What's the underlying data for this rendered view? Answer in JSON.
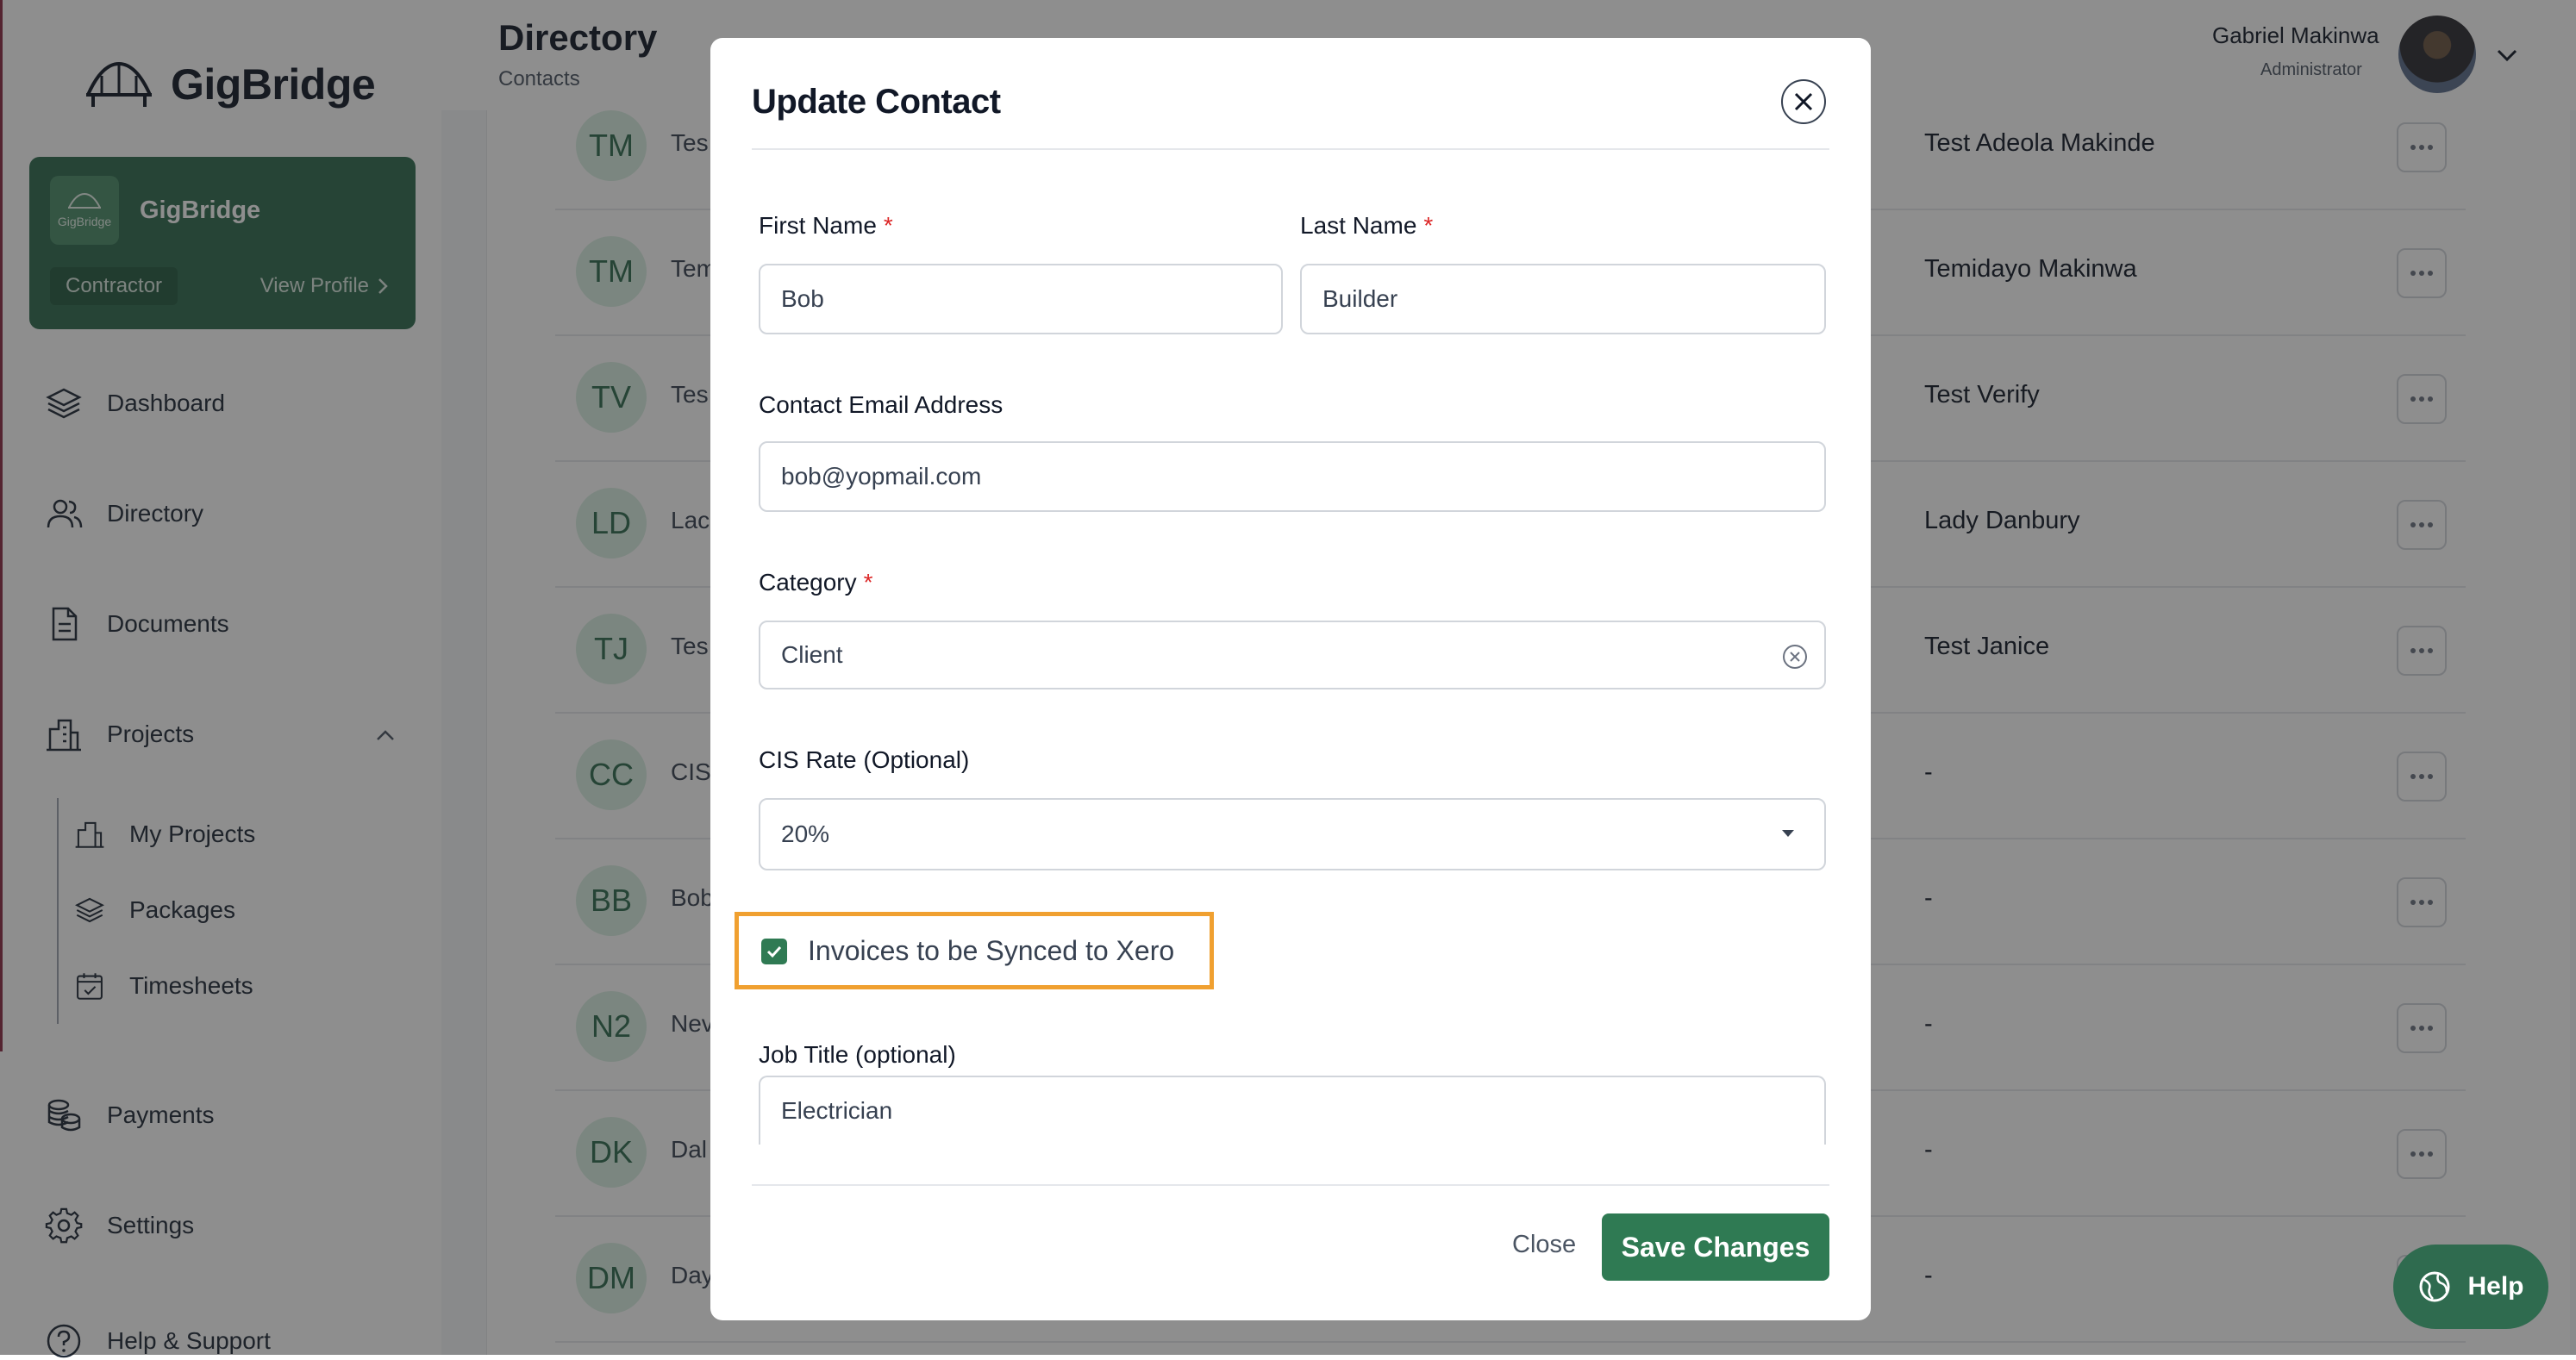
{
  "brand": {
    "name": "GigBridge"
  },
  "profile_card": {
    "logo_text": "GigBridge",
    "name": "GigBridge",
    "role": "Contractor",
    "view_profile": "View Profile"
  },
  "sidebar": {
    "items": [
      {
        "label": "Dashboard",
        "icon": "layers-icon"
      },
      {
        "label": "Directory",
        "icon": "users-icon"
      },
      {
        "label": "Documents",
        "icon": "document-icon"
      },
      {
        "label": "Projects",
        "icon": "building-icon"
      },
      {
        "label": "Payments",
        "icon": "coins-icon"
      },
      {
        "label": "Settings",
        "icon": "gear-icon"
      },
      {
        "label": "Help & Support",
        "icon": "help-icon"
      }
    ],
    "sub_items": [
      {
        "label": "My Projects",
        "icon": "building-icon"
      },
      {
        "label": "Packages",
        "icon": "layers-icon"
      },
      {
        "label": "Timesheets",
        "icon": "calendar-check-icon"
      }
    ]
  },
  "header": {
    "title": "Directory",
    "subtitle": "Contacts"
  },
  "user": {
    "name": "Gabriel Makinwa",
    "role": "Administrator"
  },
  "contacts": [
    {
      "initials": "TM",
      "short": "Tes",
      "full": "Test Adeola Makinde"
    },
    {
      "initials": "TM",
      "short": "Tem",
      "full": "Temidayo Makinwa"
    },
    {
      "initials": "TV",
      "short": "Tes",
      "full": "Test Verify"
    },
    {
      "initials": "LD",
      "short": "Lac",
      "full": "Lady Danbury"
    },
    {
      "initials": "TJ",
      "short": "Tes",
      "full": "Test Janice"
    },
    {
      "initials": "CC",
      "short": "CIS",
      "full": "-"
    },
    {
      "initials": "BB",
      "short": "Bob",
      "full": "-"
    },
    {
      "initials": "N2",
      "short": "Nev",
      "full": "-"
    },
    {
      "initials": "DK",
      "short": "Dal",
      "full": "-"
    },
    {
      "initials": "DM",
      "short": "Day",
      "full": "-"
    }
  ],
  "modal": {
    "title": "Update Contact",
    "first_name": {
      "label": "First Name",
      "required": "*",
      "value": "Bob"
    },
    "last_name": {
      "label": "Last Name",
      "required": "*",
      "value": "Builder"
    },
    "email": {
      "label": "Contact Email Address",
      "value": "bob@yopmail.com"
    },
    "category": {
      "label": "Category",
      "required": "*",
      "value": "Client"
    },
    "cis_rate": {
      "label": "CIS Rate (Optional)",
      "value": "20%"
    },
    "sync": {
      "label": "Invoices to be Synced to Xero",
      "checked": true
    },
    "job_title": {
      "label": "Job Title (optional)",
      "value": "Electrician"
    },
    "close_label": "Close",
    "save_label": "Save Changes"
  },
  "help_button": {
    "label": "Help"
  },
  "colors": {
    "brand_green": "#2f6b4f",
    "accent_orange": "#f0a030",
    "required_red": "#dc2626"
  }
}
